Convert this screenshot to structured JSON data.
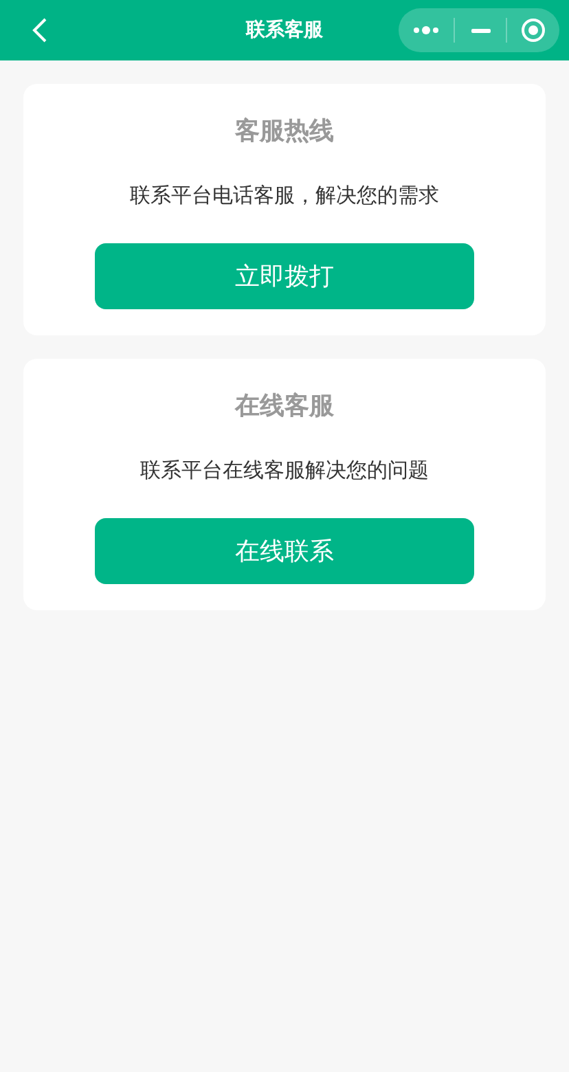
{
  "header": {
    "title": "联系客服"
  },
  "cards": [
    {
      "title": "客服热线",
      "description": "联系平台电话客服，解决您的需求",
      "button": "立即拨打"
    },
    {
      "title": "在线客服",
      "description": "联系平台在线客服解决您的问题",
      "button": "在线联系"
    }
  ]
}
